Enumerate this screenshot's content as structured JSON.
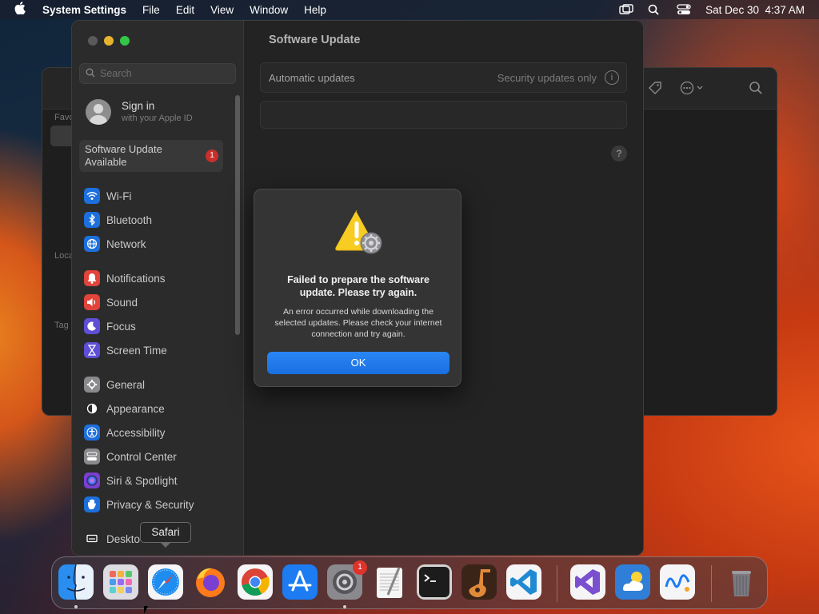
{
  "menubar": {
    "app_name": "System Settings",
    "menus": [
      "File",
      "Edit",
      "View",
      "Window",
      "Help"
    ],
    "datetime": "Sat Dec 30  4:37 AM"
  },
  "background_window": {
    "labels": [
      "Favo",
      "Loca",
      "Tag"
    ]
  },
  "sidebar": {
    "search_placeholder": "Search",
    "signin": {
      "title": "Sign in",
      "subtitle": "with your Apple ID"
    },
    "update_available": {
      "label": "Software Update Available",
      "badge": "1"
    },
    "groups": [
      [
        {
          "label": "Wi-Fi",
          "icon": "wifi-icon",
          "color": "#1d6fdc"
        },
        {
          "label": "Bluetooth",
          "icon": "bluetooth-icon",
          "color": "#1d6fdc"
        },
        {
          "label": "Network",
          "icon": "globe-icon",
          "color": "#1d6fdc"
        }
      ],
      [
        {
          "label": "Notifications",
          "icon": "bell-icon",
          "color": "#e0443a"
        },
        {
          "label": "Sound",
          "icon": "speaker-icon",
          "color": "#e0443a"
        },
        {
          "label": "Focus",
          "icon": "moon-icon",
          "color": "#5e4fd6"
        },
        {
          "label": "Screen Time",
          "icon": "hourglass-icon",
          "color": "#5e4fd6"
        }
      ],
      [
        {
          "label": "General",
          "icon": "gear-icon",
          "color": "#8a8a8e"
        },
        {
          "label": "Appearance",
          "icon": "appearance-icon",
          "color": "#2a2a2a"
        },
        {
          "label": "Accessibility",
          "icon": "accessibility-icon",
          "color": "#1d6fdc"
        },
        {
          "label": "Control Center",
          "icon": "control-center-icon",
          "color": "#8a8a8e"
        },
        {
          "label": "Siri & Spotlight",
          "icon": "siri-icon",
          "color": "#7a3fd0"
        },
        {
          "label": "Privacy & Security",
          "icon": "hand-icon",
          "color": "#1d6fdc"
        }
      ],
      [
        {
          "label": "Deskto",
          "icon": "desktop-icon",
          "color": "#2a2a2a"
        }
      ]
    ]
  },
  "content": {
    "title": "Software Update",
    "automatic_updates_label": "Automatic updates",
    "automatic_updates_value": "Security updates only",
    "info_glyph": "i",
    "help_glyph": "?"
  },
  "alert": {
    "title": "Failed to prepare the software update. Please try again.",
    "message": "An error occurred while downloading the selected updates. Please check your internet connection and try again.",
    "ok_label": "OK"
  },
  "tooltip": {
    "label": "Safari"
  },
  "dock": {
    "apps": [
      {
        "name": "Finder",
        "icon": "finder-icon",
        "color": "#2a8ef0",
        "running": true
      },
      {
        "name": "Launchpad",
        "icon": "launchpad-icon",
        "color": "#d9d9de",
        "running": false
      },
      {
        "name": "Safari",
        "icon": "safari-icon",
        "color": "#f5f5f7",
        "running": false
      },
      {
        "name": "Firefox",
        "icon": "firefox-icon",
        "color": "#ff7a1a",
        "running": false
      },
      {
        "name": "Chrome",
        "icon": "chrome-icon",
        "color": "#f5f5f7",
        "running": false
      },
      {
        "name": "App Store",
        "icon": "app-store-icon",
        "color": "#1d7cf2",
        "running": false
      },
      {
        "name": "System Settings",
        "icon": "system-settings-icon",
        "color": "#8a8a8e",
        "running": true,
        "badge": "1"
      },
      {
        "name": "TextEdit",
        "icon": "textedit-icon",
        "color": "#f2f2f2",
        "running": false
      },
      {
        "name": "Terminal",
        "icon": "terminal-icon",
        "color": "#1c1c1c",
        "running": false
      },
      {
        "name": "GarageBand",
        "icon": "garageband-icon",
        "color": "#6a3a1e",
        "running": false
      },
      {
        "name": "Visual Studio Code",
        "icon": "vscode-icon",
        "color": "#f5f5f7",
        "running": false
      },
      {
        "name": "Visual Studio",
        "icon": "visual-studio-icon",
        "color": "#f5f5f7",
        "running": false
      },
      {
        "name": "Weather",
        "icon": "weather-icon",
        "color": "#2f7fd8",
        "running": false
      },
      {
        "name": "Freeform",
        "icon": "freeform-icon",
        "color": "#f5f5f7",
        "running": false
      },
      {
        "name": "Trash",
        "icon": "trash-icon",
        "color": "#6a6a70",
        "running": false
      }
    ]
  }
}
